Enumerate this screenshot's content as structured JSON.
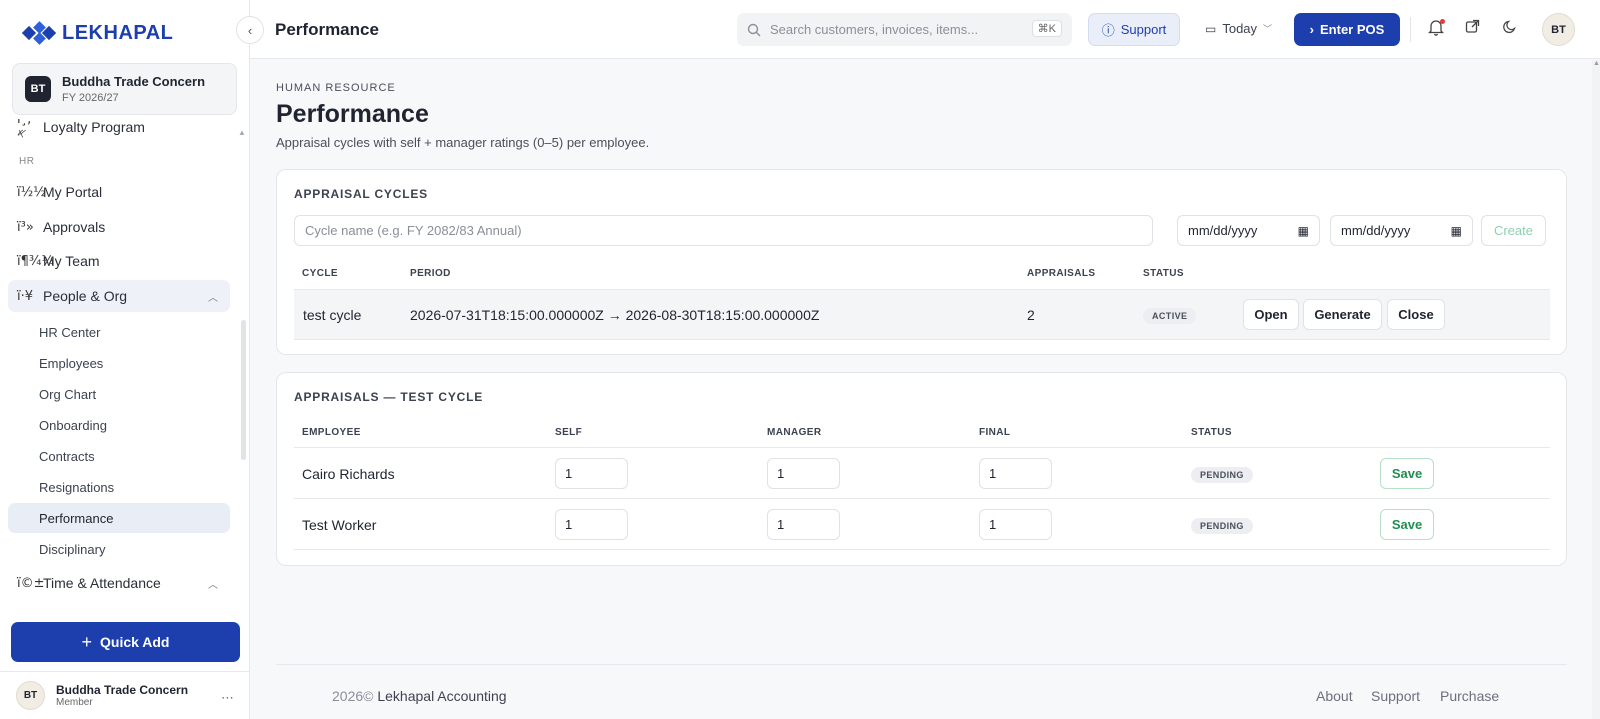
{
  "brand": {
    "name": "LEKHAPAL"
  },
  "org": {
    "initials": "BT",
    "name": "Buddha Trade Concern",
    "fy": "FY 2026/27"
  },
  "sidebar": {
    "partial_item": {
      "icon": "ï¸, 𐤀",
      "label": "Loyalty Program"
    },
    "section_hr": "HR",
    "items": [
      {
        "icon": "ï½½",
        "label": "My Portal"
      },
      {
        "icon": "ï³»",
        "label": "Approvals"
      },
      {
        "icon": "ï¶¾¼",
        "label": "My Team"
      },
      {
        "icon": "ï·¥",
        "label": "People & Org"
      },
      {
        "icon": "ï©±",
        "label": "Time & Attendance"
      }
    ],
    "people_org_sub": [
      "HR Center",
      "Employees",
      "Org Chart",
      "Onboarding",
      "Contracts",
      "Resignations",
      "Performance",
      "Disciplinary"
    ],
    "quick_add": "Quick Add"
  },
  "user": {
    "initials": "BT",
    "name": "Buddha Trade Concern",
    "role": "Member"
  },
  "topbar": {
    "title": "Performance",
    "search_placeholder": "Search customers, invoices, items...",
    "search_kbd": "⌘K",
    "support": "Support",
    "date_range": "Today",
    "enter_pos": "Enter POS",
    "avatar": "BT"
  },
  "page": {
    "eyebrow": "HUMAN RESOURCE",
    "title": "Performance",
    "description": "Appraisal cycles with self + manager ratings (0–5) per employee."
  },
  "cycles": {
    "heading": "APPRAISAL CYCLES",
    "name_placeholder": "Cycle name (e.g. FY 2082/83 Annual)",
    "start_date": "mm/dd/yyyy",
    "end_date": "mm/dd/yyyy",
    "create": "Create",
    "columns": [
      "CYCLE",
      "PERIOD",
      "APPRAISALS",
      "STATUS"
    ],
    "rows": [
      {
        "cycle": "test cycle",
        "period": "2026-07-31T18:15:00.000000Z → 2026-08-30T18:15:00.000000Z",
        "appraisals": "2",
        "status": "ACTIVE"
      }
    ],
    "actions": [
      "Open",
      "Generate",
      "Close"
    ]
  },
  "appraisals": {
    "heading": "APPRAISALS — TEST CYCLE",
    "columns": [
      "EMPLOYEE",
      "SELF",
      "MANAGER",
      "FINAL",
      "STATUS"
    ],
    "rows": [
      {
        "employee": "Cairo Richards",
        "self": "1",
        "manager": "1",
        "final": "1",
        "status": "PENDING",
        "action": "Save"
      },
      {
        "employee": "Test Worker",
        "self": "1",
        "manager": "1",
        "final": "1",
        "status": "PENDING",
        "action": "Save"
      }
    ]
  },
  "footer": {
    "year": "2026©",
    "company": "Lekhapal Accounting",
    "links": [
      "About",
      "Support",
      "Purchase"
    ]
  }
}
